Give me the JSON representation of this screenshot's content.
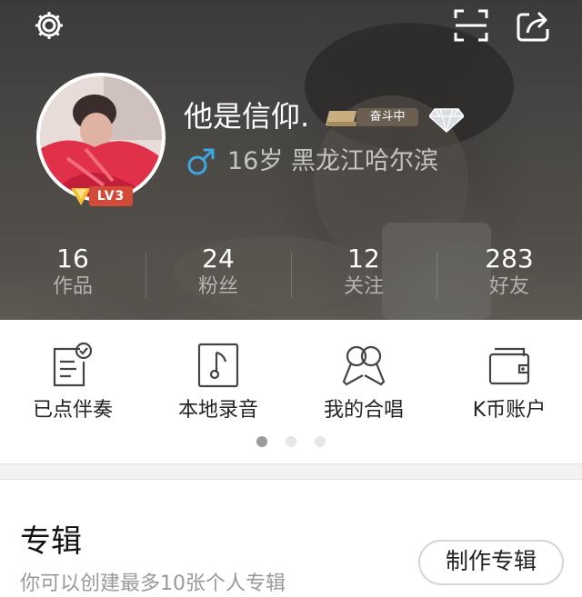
{
  "header": {
    "settings_icon": "gear-icon",
    "scan_icon": "scan-icon",
    "share_icon": "share-icon"
  },
  "profile": {
    "nickname": "他是信仰.",
    "status_badge": "奋斗中",
    "vip_icon": "diamond-icon",
    "gender_icon": "male-icon",
    "age_location": "16岁 黑龙江哈尔滨",
    "level": "LV3",
    "accent_color": "#3ea7e0"
  },
  "stats": [
    {
      "value": "16",
      "label": "作品"
    },
    {
      "value": "24",
      "label": "粉丝"
    },
    {
      "value": "12",
      "label": "关注"
    },
    {
      "value": "283",
      "label": "好友"
    }
  ],
  "quick_actions": [
    {
      "label": "已点伴奏",
      "icon": "checked-list-icon"
    },
    {
      "label": "本地录音",
      "icon": "music-note-icon"
    },
    {
      "label": "我的合唱",
      "icon": "duet-mic-icon"
    },
    {
      "label": "K币账户",
      "icon": "wallet-icon"
    }
  ],
  "pager": {
    "count": 3,
    "active": 1
  },
  "album": {
    "title": "专辑",
    "button": "制作专辑",
    "subtitle": "你可以创建最多10张个人专辑"
  }
}
